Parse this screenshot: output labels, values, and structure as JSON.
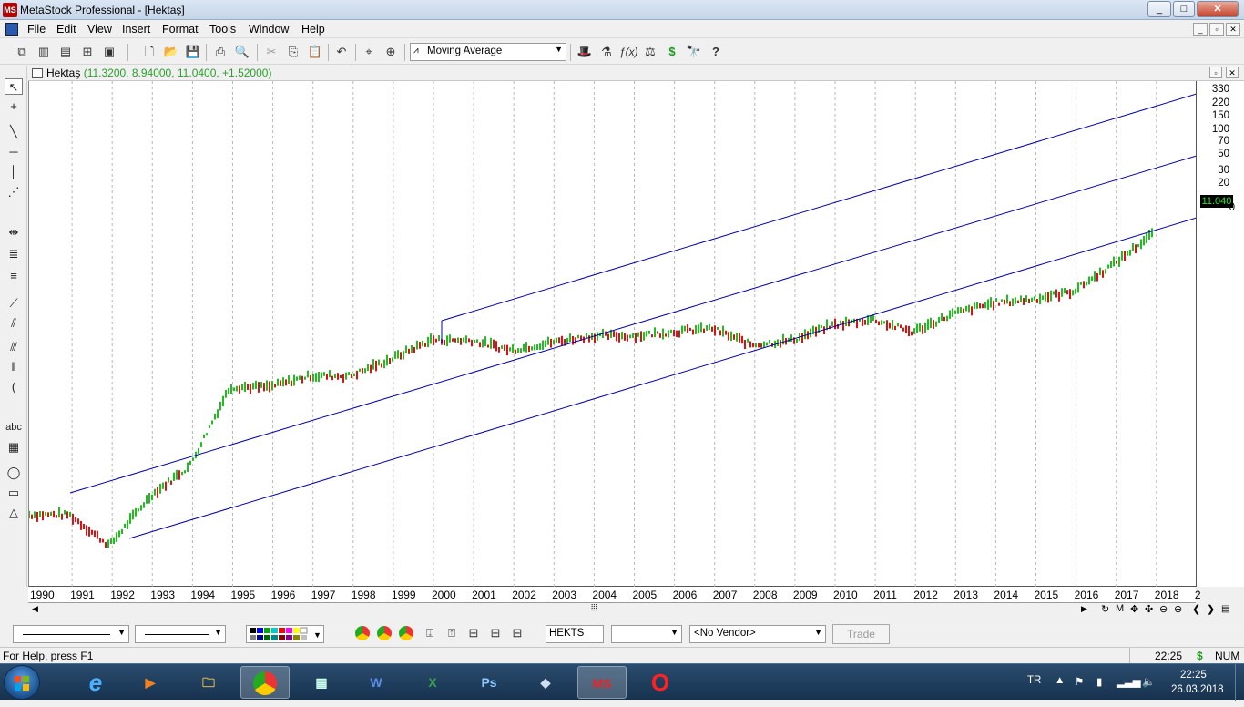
{
  "window": {
    "title": "MetaStock Professional - [Hektaş]",
    "minimize": "_",
    "maximize": "□",
    "close": "✕"
  },
  "menu": [
    "File",
    "Edit",
    "View",
    "Insert",
    "Format",
    "Tools",
    "Window",
    "Help"
  ],
  "mdi_controls": [
    "_",
    "▫",
    "✕"
  ],
  "toolbar": {
    "indicator_select": "Moving Average",
    "icons": [
      "cascade-icon",
      "tile-vertical-icon",
      "tile-horizontal-icon",
      "tile-icon",
      "layout-icon",
      "new-icon",
      "open-icon",
      "save-icon",
      "print-icon",
      "print-preview-icon",
      "cut-icon",
      "copy-icon",
      "paste-icon",
      "undo-icon",
      "crosshair-icon",
      "zoom-icon",
      "expert-icon",
      "explorer-icon",
      "formula-icon",
      "system-tester-icon",
      "dollar-icon",
      "binoculars-icon",
      "help-icon"
    ]
  },
  "drawing_tools": [
    "pointer-icon",
    "crosshair-icon",
    "trendline-icon",
    "horizontal-line-icon",
    "vertical-line-icon",
    "fan-icon",
    "speedline-icon",
    "fibonacci-icon",
    "channel-icon",
    "cycle-icon",
    "arc-icon",
    "text-icon",
    "grid-icon",
    "ellipse-icon",
    "rectangle-icon",
    "triangle-icon"
  ],
  "drawing_text": "abc",
  "chart": {
    "security_name": "Hektaş",
    "values_text": "(11.3200, 8.94000, 11.0400, +1.52000)",
    "last_price": "11.040",
    "y_ticks": [
      "330",
      "220",
      "150",
      "100",
      "70",
      "50",
      "30",
      "20",
      "0"
    ],
    "x_labels": [
      "1990",
      "1991",
      "1992",
      "1993",
      "1994",
      "1995",
      "1996",
      "1997",
      "1998",
      "1999",
      "2000",
      "2001",
      "2002",
      "2003",
      "2004",
      "2005",
      "2006",
      "2007",
      "2008",
      "2009",
      "2010",
      "2011",
      "2012",
      "2013",
      "2014",
      "2015",
      "2016",
      "2017",
      "2018",
      "2"
    ],
    "up_color": "#22bb22",
    "down_color": "#dd1111",
    "channel_color": "#0000aa"
  },
  "chart_data": {
    "type": "line",
    "title": "Hektaş",
    "x": [
      1990,
      1991,
      1992,
      1993,
      1994,
      1995,
      1996,
      1997,
      1998,
      1999,
      2000,
      2001,
      2002,
      2003,
      2004,
      2005,
      2006,
      2007,
      2008,
      2009,
      2010,
      2011,
      2012,
      2013,
      2014,
      2015,
      2016,
      2017,
      2018
    ],
    "series": [
      {
        "name": "Hektaş",
        "values": [
          0.02,
          0.02,
          0.01,
          0.03,
          0.06,
          0.35,
          0.35,
          0.45,
          0.45,
          0.65,
          1.0,
          1.0,
          0.8,
          0.95,
          1.1,
          1.1,
          1.2,
          1.3,
          0.9,
          1.0,
          1.4,
          1.6,
          1.2,
          1.8,
          2.3,
          2.5,
          3.0,
          5.5,
          11.04
        ]
      }
    ],
    "y_scale": "log",
    "last_value": 11.04,
    "grid": "vertical dashed"
  },
  "bottom": {
    "symbol": "HEKTS",
    "vendor": "<No Vendor>",
    "trade_label": "Trade"
  },
  "status": {
    "help": "For Help, press F1",
    "time": "22:25",
    "dollar": "$",
    "num": "NUM"
  },
  "taskbar": {
    "lang": "TR",
    "clock_time": "22:25",
    "clock_date": "26.03.2018"
  }
}
